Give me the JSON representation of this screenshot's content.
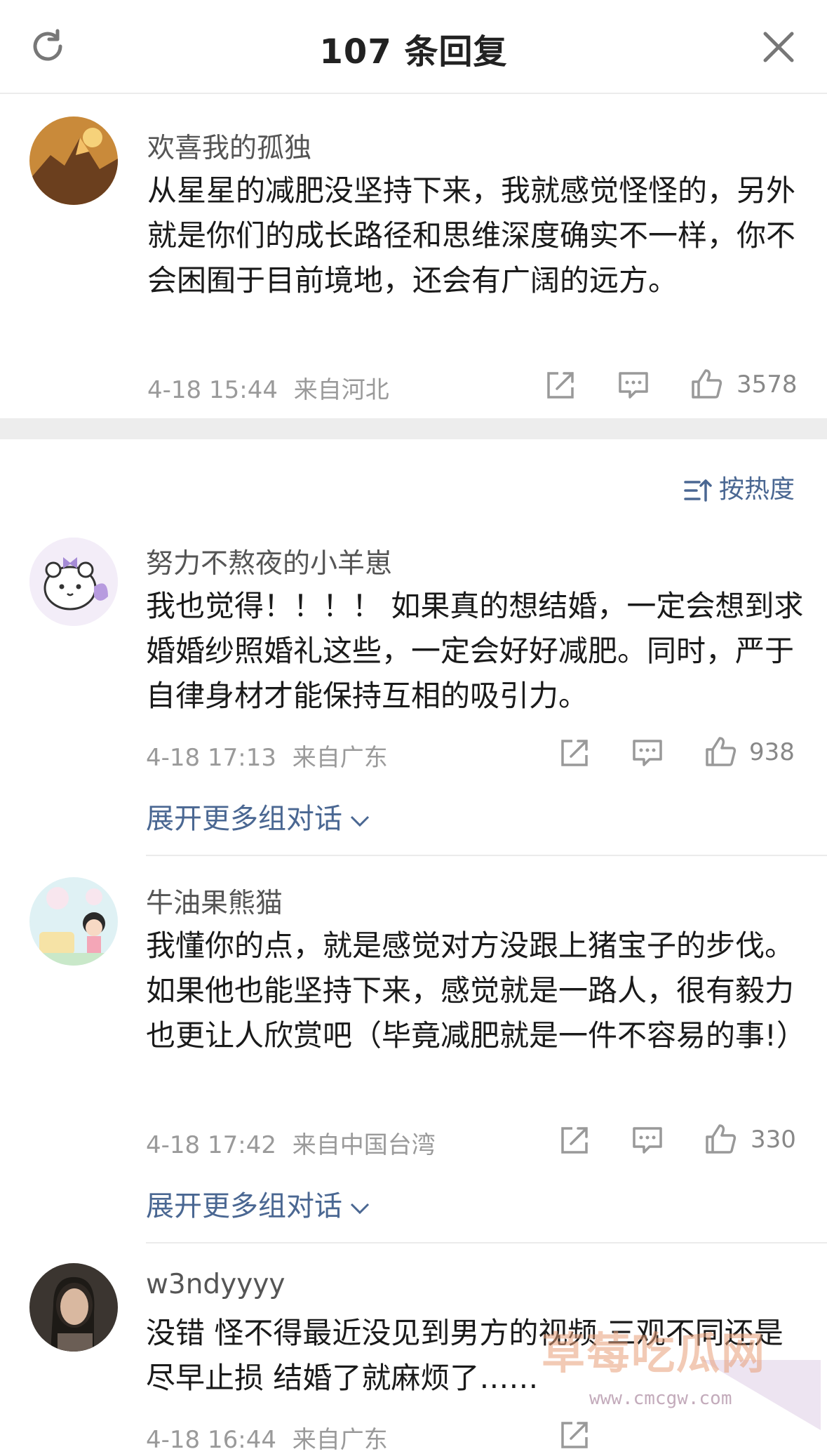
{
  "header": {
    "title": "107 条回复"
  },
  "root": {
    "name": "欢喜我的孤独",
    "text": "从星星的减肥没坚持下来，我就感觉怪怪的，另外就是你们的成长路径和思维深度确实不一样，你不会困囿于目前境地，还会有广阔的远方。",
    "time": "4-18 15:44",
    "location": "来自河北",
    "likes": "3578"
  },
  "sort": {
    "label": "按热度"
  },
  "comments": [
    {
      "name": "努力不熬夜的小羊崽",
      "text": "我也觉得！！！！ 如果真的想结婚，一定会想到求婚婚纱照婚礼这些，一定会好好减肥。同时，严于自律身材才能保持互相的吸引力。",
      "time": "4-18 17:13",
      "location": "来自广东",
      "likes": "938",
      "expand": "展开更多组对话"
    },
    {
      "name": "牛油果熊猫",
      "text": "我懂你的点，就是感觉对方没跟上猪宝子的步伐。如果他也能坚持下来，感觉就是一路人，很有毅力也更让人欣赏吧（毕竟减肥就是一件不容易的事!）",
      "time": "4-18 17:42",
      "location": "来自中国台湾",
      "likes": "330",
      "expand": "展开更多组对话"
    },
    {
      "name": "w3ndyyyy",
      "text": "没错 怪不得最近没见到男方的视频 三观不同还是尽早止损 结婚了就麻烦了……",
      "time": "4-18 16:44",
      "location": "来自广东",
      "likes": ""
    }
  ],
  "watermark": {
    "text": "草莓吃瓜网",
    "url": "www.cmcgw.com"
  },
  "colors": {
    "link": "#4a6792",
    "meta": "#9a9a9a",
    "band": "#ededed"
  },
  "icons": [
    "refresh-icon",
    "close-icon",
    "share-icon",
    "comment-icon",
    "like-icon",
    "sort-icon",
    "chevron-down-icon"
  ]
}
